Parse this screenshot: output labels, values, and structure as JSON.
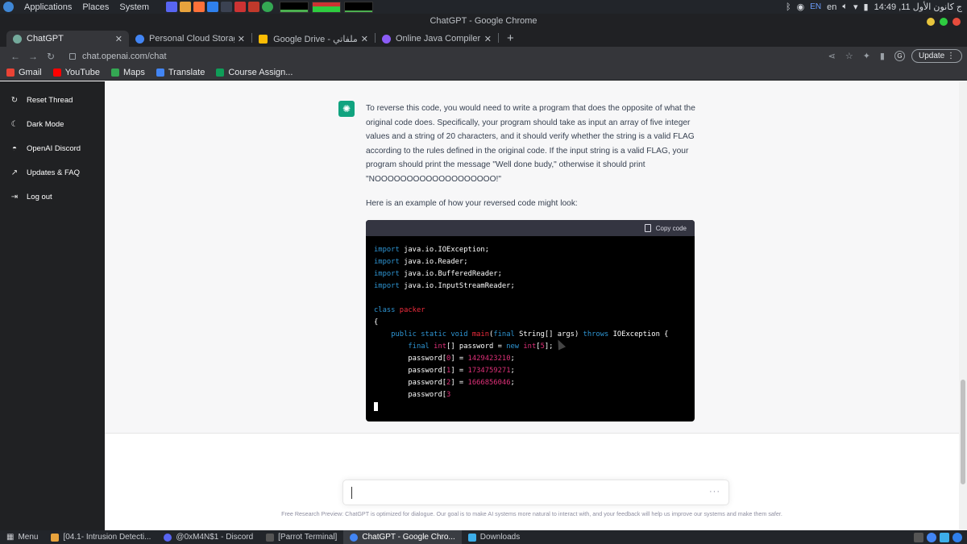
{
  "os_panel": {
    "menus": [
      "Applications",
      "Places",
      "System"
    ],
    "lang": "EN",
    "layout": "en",
    "clock": "ج كانون الأول 11, 14:49"
  },
  "window": {
    "title": "ChatGPT - Google Chrome"
  },
  "tabs": [
    {
      "label": "ChatGPT",
      "active": true,
      "icon_color": "#74aa9c"
    },
    {
      "label": "Personal Cloud Storage &",
      "active": false,
      "icon_color": "#4285f4"
    },
    {
      "label": "Google Drive - ملفاتي",
      "active": false,
      "icon_color": "#fbbc04"
    },
    {
      "label": "Online Java Compiler",
      "active": false,
      "icon_color": "#8b5cf6"
    }
  ],
  "omnibox": {
    "url": "chat.openai.com/chat",
    "profile_initial": "G",
    "update_label": "Update"
  },
  "bookmarks": [
    {
      "label": "Gmail",
      "color": "#ea4335"
    },
    {
      "label": "YouTube",
      "color": "#ff0000"
    },
    {
      "label": "Maps",
      "color": "#34a853"
    },
    {
      "label": "Translate",
      "color": "#4285f4"
    },
    {
      "label": "Course Assign...",
      "color": "#0f9d58"
    }
  ],
  "sidebar": {
    "items": [
      {
        "label": "Reset Thread",
        "icon": "refresh-icon"
      },
      {
        "label": "Dark Mode",
        "icon": "moon-icon"
      },
      {
        "label": "OpenAI Discord",
        "icon": "discord-icon"
      },
      {
        "label": "Updates & FAQ",
        "icon": "external-link-icon"
      },
      {
        "label": "Log out",
        "icon": "logout-icon"
      }
    ]
  },
  "chat": {
    "answer_paragraph_1": "To reverse this code, you would need to write a program that does the opposite of what the original code does. Specifically, your program should take as input an array of five integer values and a string of 20 characters, and it should verify whether the string is a valid FLAG according to the rules defined in the original code. If the input string is a valid FLAG, your program should print the message \"Well done budy,\" otherwise it should print \"NOOOOOOOOOOOOOOOOOOO!\"",
    "answer_paragraph_2": "Here is an example of how your reversed code might look:",
    "copy_code_label": "Copy code",
    "code_lines": [
      [
        {
          "t": "import",
          "c": "kw"
        },
        {
          "t": " java.io.IOException;",
          "c": "pl"
        }
      ],
      [
        {
          "t": "import",
          "c": "kw"
        },
        {
          "t": " java.io.Reader;",
          "c": "pl"
        }
      ],
      [
        {
          "t": "import",
          "c": "kw"
        },
        {
          "t": " java.io.BufferedReader;",
          "c": "pl"
        }
      ],
      [
        {
          "t": "import",
          "c": "kw"
        },
        {
          "t": " java.io.InputStreamReader;",
          "c": "pl"
        }
      ],
      [],
      [
        {
          "t": "class",
          "c": "kw"
        },
        {
          "t": " ",
          "c": "pl"
        },
        {
          "t": "packer",
          "c": "fn"
        }
      ],
      [
        {
          "t": "{",
          "c": "pl"
        }
      ],
      [
        {
          "t": "    ",
          "c": "pl"
        },
        {
          "t": "public",
          "c": "kw"
        },
        {
          "t": " ",
          "c": "pl"
        },
        {
          "t": "static",
          "c": "kw"
        },
        {
          "t": " ",
          "c": "pl"
        },
        {
          "t": "void",
          "c": "kw"
        },
        {
          "t": " ",
          "c": "pl"
        },
        {
          "t": "main",
          "c": "fn"
        },
        {
          "t": "(",
          "c": "pl"
        },
        {
          "t": "final",
          "c": "kw"
        },
        {
          "t": " String[] args) ",
          "c": "pl"
        },
        {
          "t": "throws",
          "c": "kw"
        },
        {
          "t": " IOException {",
          "c": "pl"
        }
      ],
      [
        {
          "t": "        ",
          "c": "pl"
        },
        {
          "t": "final",
          "c": "kw"
        },
        {
          "t": " ",
          "c": "pl"
        },
        {
          "t": "int",
          "c": "ty"
        },
        {
          "t": "[] password = ",
          "c": "pl"
        },
        {
          "t": "new",
          "c": "kw"
        },
        {
          "t": " ",
          "c": "pl"
        },
        {
          "t": "int",
          "c": "ty"
        },
        {
          "t": "[",
          "c": "pl"
        },
        {
          "t": "5",
          "c": "num"
        },
        {
          "t": "];",
          "c": "pl"
        }
      ],
      [
        {
          "t": "        password[",
          "c": "pl"
        },
        {
          "t": "0",
          "c": "num"
        },
        {
          "t": "] = ",
          "c": "pl"
        },
        {
          "t": "1429423210",
          "c": "num"
        },
        {
          "t": ";",
          "c": "pl"
        }
      ],
      [
        {
          "t": "        password[",
          "c": "pl"
        },
        {
          "t": "1",
          "c": "num"
        },
        {
          "t": "] = ",
          "c": "pl"
        },
        {
          "t": "1734759271",
          "c": "num"
        },
        {
          "t": ";",
          "c": "pl"
        }
      ],
      [
        {
          "t": "        password[",
          "c": "pl"
        },
        {
          "t": "2",
          "c": "num"
        },
        {
          "t": "] = ",
          "c": "pl"
        },
        {
          "t": "1666856046",
          "c": "num"
        },
        {
          "t": ";",
          "c": "pl"
        }
      ],
      [
        {
          "t": "        password[",
          "c": "pl"
        },
        {
          "t": "3",
          "c": "num"
        }
      ]
    ],
    "input_placeholder": "",
    "footer_note": "Free Research Preview: ChatGPT is optimized for dialogue. Our goal is to make AI systems more natural to interact with, and your feedback will help us improve our systems and make them safer."
  },
  "taskbar": {
    "menu_label": "Menu",
    "tasks": [
      {
        "label": "[04.1- Intrusion Detecti...",
        "color": "#e8a33d",
        "active": false
      },
      {
        "label": "@0xM4N$1 - Discord",
        "color": "#5865f2",
        "active": false
      },
      {
        "label": "[Parrot Terminal]",
        "color": "#555555",
        "active": false
      },
      {
        "label": "ChatGPT - Google Chro...",
        "color": "#4285f4",
        "active": true
      },
      {
        "label": "Downloads",
        "color": "#3daee9",
        "active": false
      }
    ]
  },
  "colors": {
    "accent": "#10a37f",
    "sidebar_bg": "#202123",
    "chrome_dark": "#202124"
  }
}
